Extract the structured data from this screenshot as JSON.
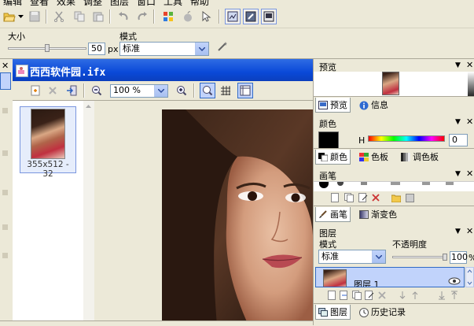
{
  "menu": {
    "items": [
      "编辑",
      "查看",
      "效果",
      "调整",
      "图层",
      "窗口",
      "工具",
      "帮助"
    ]
  },
  "options": {
    "size_label": "大小",
    "size_value": "50",
    "size_unit": "px",
    "size_level": 0.5,
    "mode_label": "模式",
    "mode_value": "标准"
  },
  "document": {
    "title": "西西软件园.ifx",
    "zoom_value": "100 %",
    "thumbnail_caption": "355x512 - 32"
  },
  "panels": {
    "preview": {
      "title": "预览",
      "tab_preview": "预览",
      "tab_info": "信息"
    },
    "color": {
      "title": "颜色",
      "h_label": "H",
      "h_value": "0",
      "tab_color": "颜色",
      "tab_swatch": "色板",
      "tab_palette": "调色板"
    },
    "brush": {
      "title": "画笔",
      "tab_brush": "画笔",
      "tab_gradient": "渐变色"
    },
    "layers": {
      "title": "图层",
      "mode_label": "模式",
      "opacity_label": "不透明度",
      "mode_value": "标准",
      "opacity_value": "100",
      "opacity_unit": "%",
      "opacity_level": 1.0,
      "layer_name": "图层 1",
      "tab_layers": "图层",
      "tab_history": "历史记录"
    }
  },
  "colors": {
    "titlebar": "#0a49d8",
    "panel_bg": "#ece9d8",
    "selection": "#c1d3fb"
  }
}
